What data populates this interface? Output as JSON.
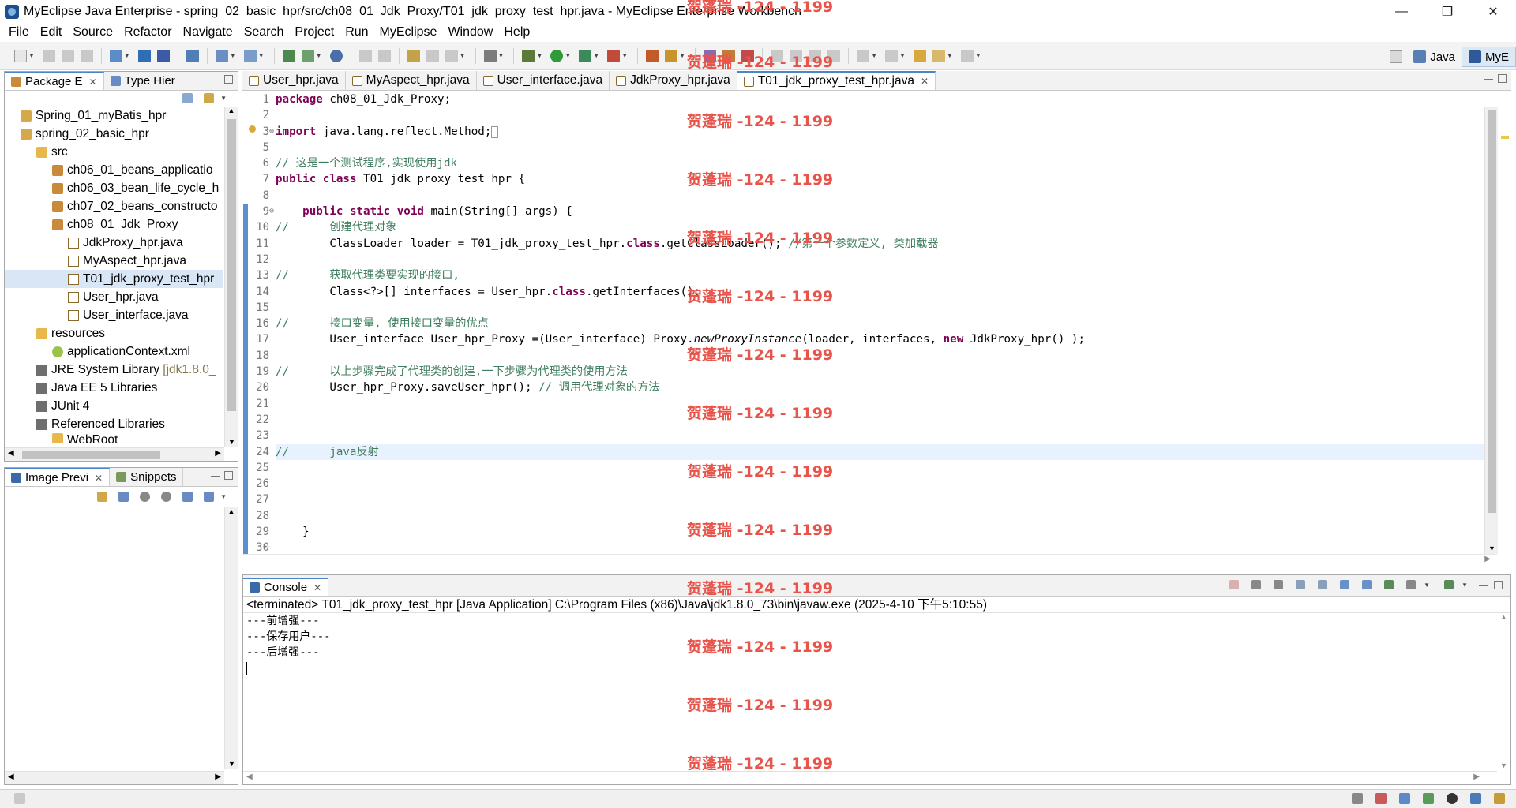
{
  "window": {
    "title": "MyEclipse Java Enterprise - spring_02_basic_hpr/src/ch08_01_Jdk_Proxy/T01_jdk_proxy_test_hpr.java - MyEclipse Enterprise Workbench"
  },
  "menu": [
    "File",
    "Edit",
    "Source",
    "Refactor",
    "Navigate",
    "Search",
    "Project",
    "Run",
    "MyEclipse",
    "Window",
    "Help"
  ],
  "perspectives": {
    "java": "Java",
    "myeclipse": "MyE"
  },
  "package_explorer": {
    "tabs": [
      "Package E",
      "Type Hier"
    ],
    "tree": [
      {
        "label": "Spring_01_myBatis_hpr",
        "icon": "project-icon"
      },
      {
        "label": "spring_02_basic_hpr",
        "icon": "project-icon"
      },
      {
        "label": "src",
        "icon": "source-folder-icon"
      },
      {
        "label": "ch06_01_beans_applicatio",
        "icon": "package-icon"
      },
      {
        "label": "ch06_03_bean_life_cycle_h",
        "icon": "package-icon"
      },
      {
        "label": "ch07_02_beans_constructo",
        "icon": "package-icon"
      },
      {
        "label": "ch08_01_Jdk_Proxy",
        "icon": "package-icon"
      },
      {
        "label": "JdkProxy_hpr.java",
        "icon": "java-file-icon"
      },
      {
        "label": "MyAspect_hpr.java",
        "icon": "java-file-icon"
      },
      {
        "label": "T01_jdk_proxy_test_hpr",
        "icon": "java-file-icon"
      },
      {
        "label": "User_hpr.java",
        "icon": "java-file-icon"
      },
      {
        "label": "User_interface.java",
        "icon": "java-file-icon"
      },
      {
        "label": "resources",
        "icon": "source-folder-icon"
      },
      {
        "label": "applicationContext.xml",
        "icon": "xml-file-icon"
      },
      {
        "label": "JRE System Library",
        "icon": "library-icon",
        "note": "[jdk1.8.0_"
      },
      {
        "label": "Java EE 5 Libraries",
        "icon": "library-icon"
      },
      {
        "label": "JUnit 4",
        "icon": "library-icon"
      },
      {
        "label": "Referenced Libraries",
        "icon": "library-icon"
      },
      {
        "label": "WebRoot",
        "icon": "folder-icon"
      }
    ]
  },
  "lower_left": {
    "tabs": [
      "Image Previ",
      "Snippets"
    ]
  },
  "editor": {
    "tabs": [
      "User_hpr.java",
      "MyAspect_hpr.java",
      "User_interface.java",
      "JdkProxy_hpr.java",
      "T01_jdk_proxy_test_hpr.java"
    ],
    "lines": [
      {
        "n": "1",
        "t": "package ch08_01_Jdk_Proxy;"
      },
      {
        "n": "2",
        "t": ""
      },
      {
        "n": "3",
        "t": "import java.lang.reflect.Method;"
      },
      {
        "n": "5",
        "t": ""
      },
      {
        "n": "6",
        "t": "// 这是一个测试程序,实现使用jdk"
      },
      {
        "n": "7",
        "t": "public class T01_jdk_proxy_test_hpr {"
      },
      {
        "n": "8",
        "t": ""
      },
      {
        "n": "9",
        "t": "    public static void main(String[] args) {"
      },
      {
        "n": "10",
        "t": "//      创建代理对象"
      },
      {
        "n": "11",
        "t": "        ClassLoader loader = T01_jdk_proxy_test_hpr.class.getClassLoader(); //第一个参数定义, 类加载器"
      },
      {
        "n": "12",
        "t": ""
      },
      {
        "n": "13",
        "t": "//      获取代理类要实现的接口,"
      },
      {
        "n": "14",
        "t": "        Class<?>[] interfaces = User_hpr.class.getInterfaces();"
      },
      {
        "n": "15",
        "t": ""
      },
      {
        "n": "16",
        "t": "//      接口变量, 使用接口变量的优点"
      },
      {
        "n": "17",
        "t": "        User_interface User_hpr_Proxy =(User_interface) Proxy.newProxyInstance(loader, interfaces, new JdkProxy_hpr() );"
      },
      {
        "n": "18",
        "t": ""
      },
      {
        "n": "19",
        "t": "//      以上步骤完成了代理类的创建,一下步骤为代理类的使用方法"
      },
      {
        "n": "20",
        "t": "        User_hpr_Proxy.saveUser_hpr(); // 调用代理对象的方法"
      },
      {
        "n": "21",
        "t": ""
      },
      {
        "n": "22",
        "t": ""
      },
      {
        "n": "23",
        "t": ""
      },
      {
        "n": "24",
        "t": "//      java反射"
      },
      {
        "n": "25",
        "t": ""
      },
      {
        "n": "26",
        "t": ""
      },
      {
        "n": "27",
        "t": ""
      },
      {
        "n": "28",
        "t": ""
      },
      {
        "n": "29",
        "t": "    }"
      },
      {
        "n": "30",
        "t": ""
      }
    ]
  },
  "console": {
    "tab": "Console",
    "description": "<terminated> T01_jdk_proxy_test_hpr [Java Application] C:\\Program Files (x86)\\Java\\jdk1.8.0_73\\bin\\javaw.exe (2025-4-10 下午5:10:55)",
    "output": [
      "---前增强---",
      "---保存用户---",
      "---后增强---"
    ]
  },
  "watermark": "贺蓬瑞 -124 - 1199",
  "colors": {
    "keyword": "#7f0055",
    "comment": "#3f7f5f",
    "watermark": "#e8534a",
    "selection": "#d8e6f6"
  }
}
